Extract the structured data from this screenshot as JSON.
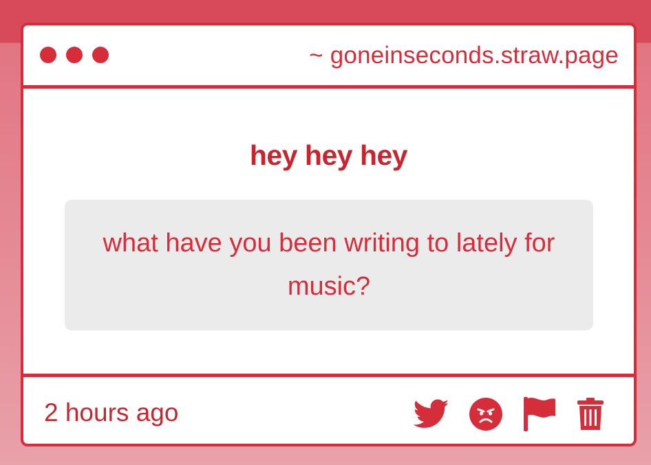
{
  "window": {
    "url": "~ goneinseconds.straw.page",
    "dots": [
      "window-dot-1",
      "window-dot-2",
      "window-dot-3"
    ]
  },
  "content": {
    "heading": "hey hey hey",
    "question": "what have you been writing to lately for music?"
  },
  "footer": {
    "timestamp": "2 hours ago",
    "actions": [
      {
        "icon": "twitter-icon",
        "action": "share-twitter"
      },
      {
        "icon": "angry-face-icon",
        "action": "react-angry"
      },
      {
        "icon": "flag-icon",
        "action": "report"
      },
      {
        "icon": "trash-icon",
        "action": "delete"
      }
    ]
  },
  "colors": {
    "accent": "#d62d3a",
    "background_top": "#d8495a",
    "background_bottom": "#e9a1aa",
    "question_box": "#ecebec"
  }
}
